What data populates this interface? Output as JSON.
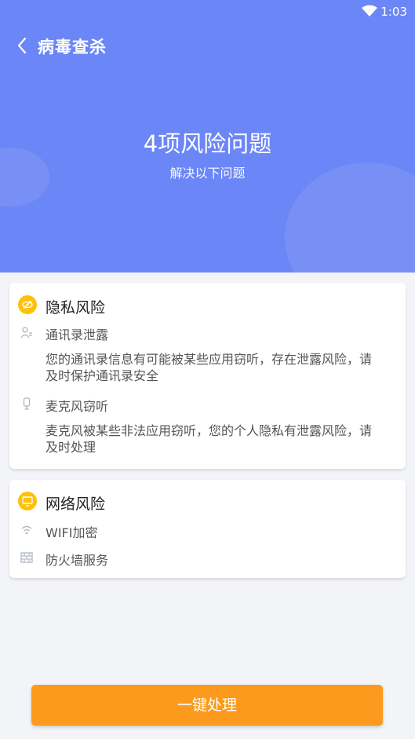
{
  "status_bar": {
    "time": "1:03"
  },
  "nav": {
    "title": "病毒查杀"
  },
  "hero": {
    "title": "4项风险问题",
    "subtitle": "解决以下问题"
  },
  "privacy_card": {
    "title": "隐私风险",
    "items": [
      {
        "icon": "contact-icon",
        "title": "通讯录泄露",
        "desc": "您的通讯录信息有可能被某些应用窃听，存在泄露风险，请及时保护通讯录安全"
      },
      {
        "icon": "microphone-icon",
        "title": "麦克风窃听",
        "desc": "麦克风被某些非法应用窃听，您的个人隐私有泄露风险，请及时处理"
      }
    ]
  },
  "network_card": {
    "title": "网络风险",
    "items": [
      {
        "icon": "wifi-icon",
        "title": "WIFI加密"
      },
      {
        "icon": "firewall-icon",
        "title": "防火墙服务"
      }
    ]
  },
  "action": {
    "label": "一键处理"
  },
  "colors": {
    "header": "#6b86f6",
    "accent": "#fb9a1c",
    "badge": "#ffc107",
    "background": "#f3f4f8"
  }
}
